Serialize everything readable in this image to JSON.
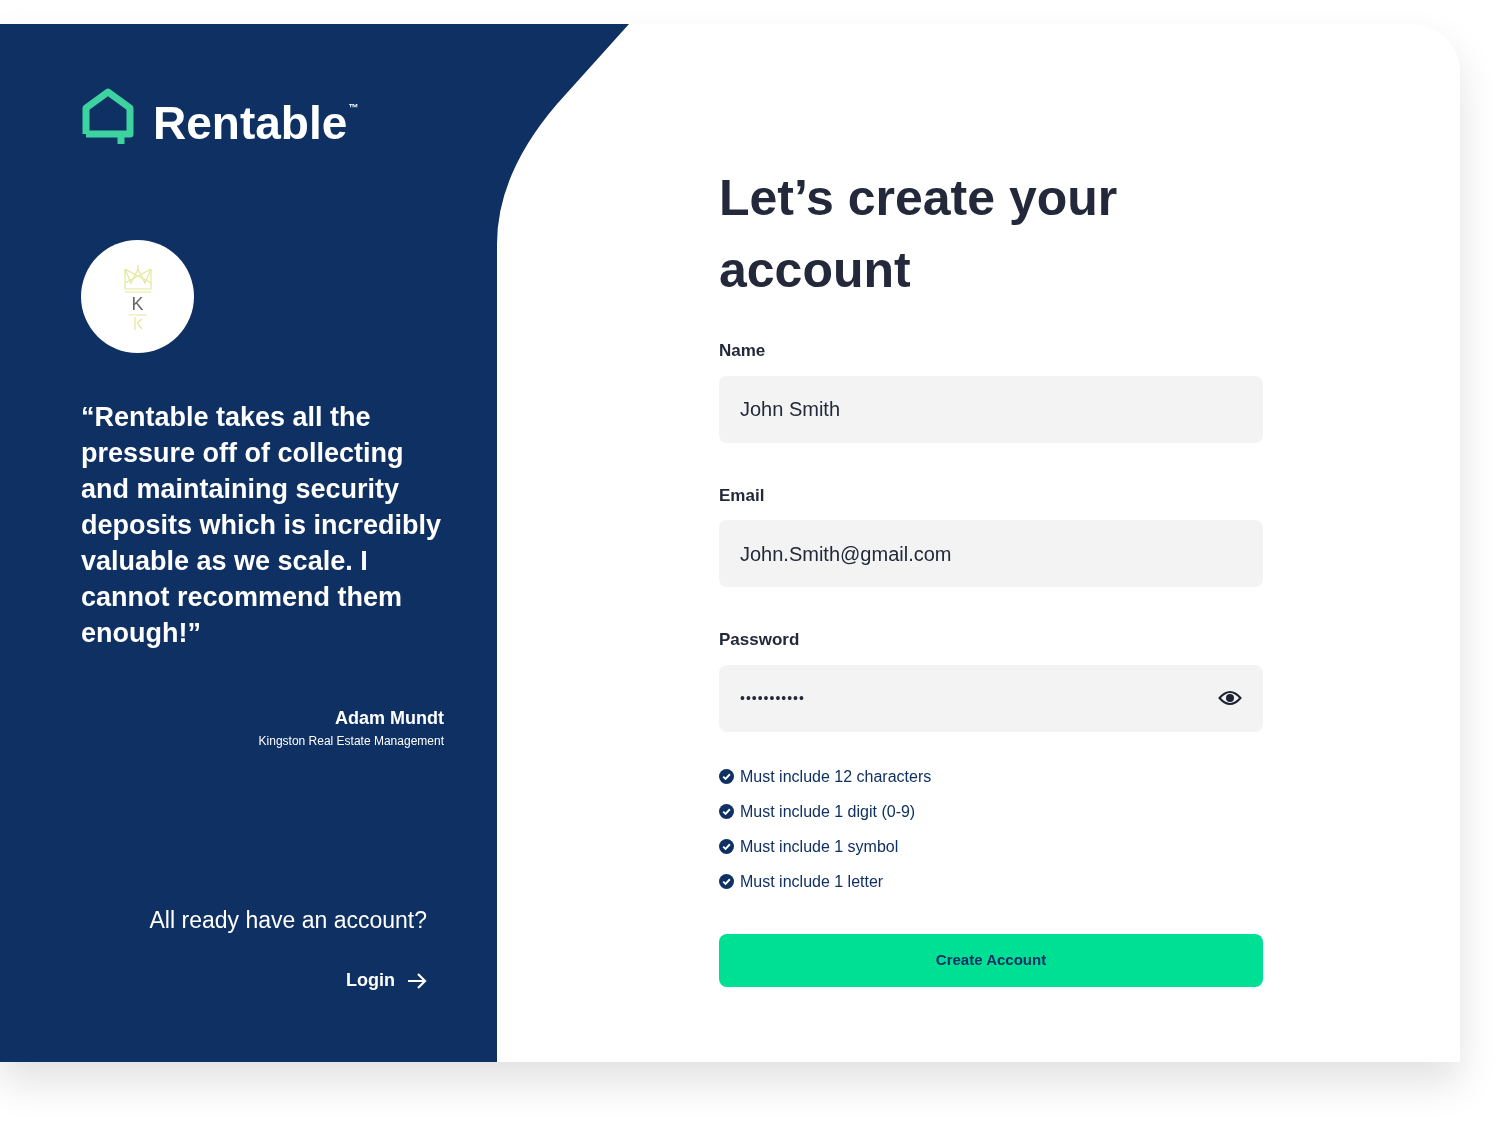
{
  "brand": {
    "name": "Rentable",
    "mark": "™"
  },
  "testimonial": {
    "logo_letter": "K",
    "quote": "“Rentable takes all the pressure off of collecting and maintaining security deposits which is incredibly valuable as we scale. I cannot recommend them enough!”",
    "author": "Adam Mundt",
    "company": "Kingston Real Estate Management"
  },
  "login_prompt": {
    "text": "All ready have an account?",
    "link": "Login"
  },
  "form": {
    "title": "Let’s create your account",
    "fields": [
      {
        "label": "Name",
        "value": "John Smith",
        "kind": "text"
      },
      {
        "label": "Email",
        "value": "John.Smith@gmail.com",
        "kind": "text"
      },
      {
        "label": "Password",
        "value": "•••••••••••",
        "kind": "password"
      }
    ],
    "requirements": [
      {
        "text": "Must include 12 characters",
        "checked": true
      },
      {
        "text": "Must include 1 digit (0-9)",
        "checked": true
      },
      {
        "text": "Must include 1 symbol",
        "checked": true
      },
      {
        "text": "Must include 1 letter",
        "checked": true
      }
    ],
    "submit": "Create Account"
  }
}
